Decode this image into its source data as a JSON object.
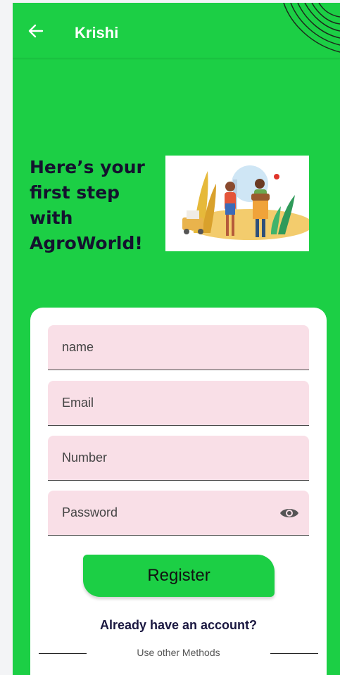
{
  "appbar": {
    "title": "Krishi"
  },
  "hero": {
    "headline": "Here’s your first step with AgroWorld!"
  },
  "form": {
    "fields": [
      {
        "placeholder": "name"
      },
      {
        "placeholder": "Email"
      },
      {
        "placeholder": "Number"
      },
      {
        "placeholder": "Password"
      }
    ],
    "register_label": "Register",
    "login_link": "Already have an account?",
    "other_methods": "Use other Methods"
  },
  "colors": {
    "brand": "#1ccf45",
    "field_bg": "#f9dfe7",
    "dark_text": "#14122e"
  },
  "icons": {
    "back": "arrow-left-icon",
    "password_toggle": "eye-icon"
  }
}
